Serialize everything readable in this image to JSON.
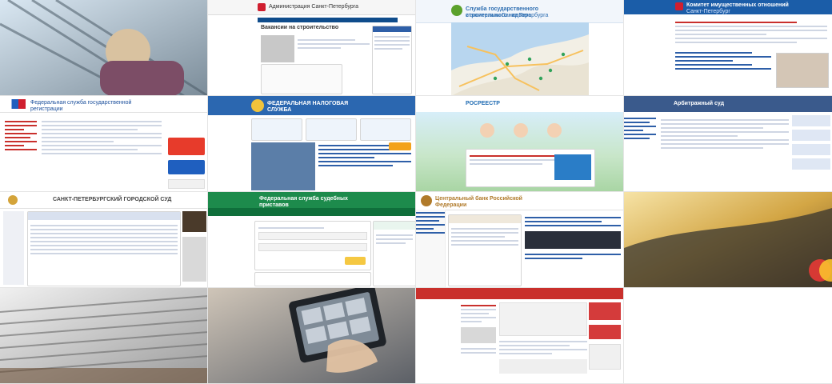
{
  "tiles": [
    {
      "id": "r1c1",
      "kind": "photo",
      "label": "",
      "accent": "#6d7b86"
    },
    {
      "id": "r1c2",
      "kind": "site",
      "title": "Администрация Санкт-Петербурга",
      "subtitle": "Вакансии на строительство",
      "accent": "#d01f2f"
    },
    {
      "id": "r1c3",
      "kind": "map",
      "title": "Служба государственного строительного надзора",
      "subtitle": "и экспертизы Санкт-Петербурга",
      "accent": "#2f6fb2"
    },
    {
      "id": "r1c4",
      "kind": "site",
      "title": "Комитет имущественных отношений",
      "subtitle": "Санкт-Петербург",
      "accent": "#1b5da8"
    },
    {
      "id": "r2c1",
      "kind": "site",
      "title": "Федеральная служба государственной регистрации",
      "subtitle": "",
      "accent": "#d01f2f"
    },
    {
      "id": "r2c2",
      "kind": "site",
      "title": "ФЕДЕРАЛЬНАЯ НАЛОГОВАЯ СЛУЖБА",
      "subtitle": "",
      "accent": "#1e62b0"
    },
    {
      "id": "r2c3",
      "kind": "site",
      "title": "РОСРЕЕСТР",
      "subtitle": "",
      "accent": "#1f6bb2"
    },
    {
      "id": "r2c4",
      "kind": "site",
      "title": "Арбитражный суд",
      "subtitle": "",
      "accent": "#3a5a8c"
    },
    {
      "id": "r3c1",
      "kind": "site",
      "title": "САНКТ-ПЕТЕРБУРГСКИЙ ГОРОДСКОЙ СУД",
      "subtitle": "",
      "accent": "#8a8a8a"
    },
    {
      "id": "r3c2",
      "kind": "site",
      "title": "Федеральная служба судебных приставов",
      "subtitle": "",
      "accent": "#1d8b4c"
    },
    {
      "id": "r3c3",
      "kind": "site",
      "title": "Центральный банк Российской Федерации",
      "subtitle": "",
      "accent": "#b07a2a"
    },
    {
      "id": "r3c4",
      "kind": "photo",
      "label": "",
      "accent": "#c99b2a"
    },
    {
      "id": "r4c1",
      "kind": "photo",
      "label": "",
      "accent": "#7a7a7a"
    },
    {
      "id": "r4c2",
      "kind": "photo",
      "label": "",
      "accent": "#5b5f66"
    },
    {
      "id": "r4c3",
      "kind": "site",
      "title": "",
      "subtitle": "",
      "accent": "#c9302c"
    },
    {
      "id": "r4c4",
      "kind": "blank",
      "label": "",
      "accent": "#ffffff"
    }
  ]
}
